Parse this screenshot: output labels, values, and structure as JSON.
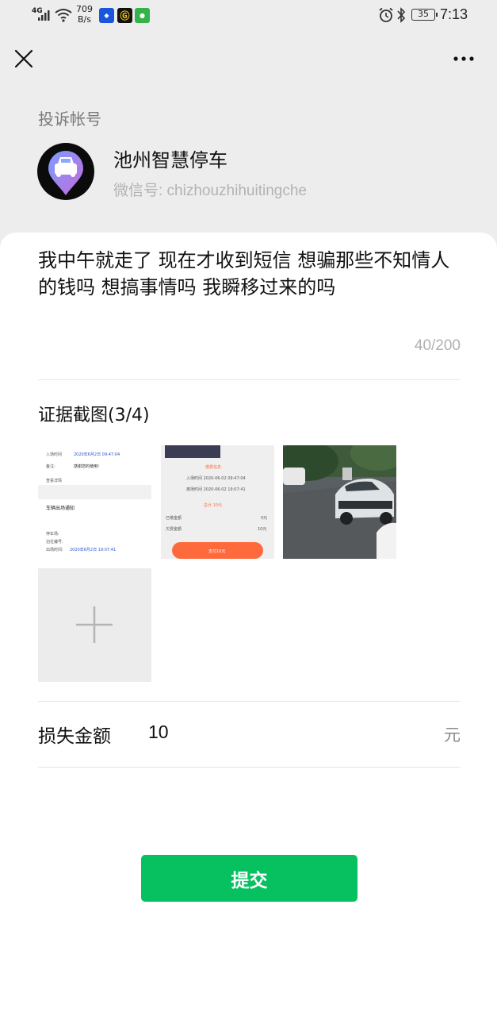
{
  "status_bar": {
    "network": "4G",
    "speed_value": "709",
    "speed_unit": "B/s",
    "battery": "35",
    "time": "7:13",
    "app_icons": [
      "shield-app-icon",
      "g-app-icon",
      "wechat-app-icon"
    ]
  },
  "nav": {
    "close_icon": "close-icon",
    "more_icon": "more-icon"
  },
  "account": {
    "section_label": "投诉帐号",
    "name": "池州智慧停车",
    "wechat_id": "微信号: chizhouzhihuitingche"
  },
  "complaint": {
    "text": "我中午就走了 现在才收到短信 想骗那些不知情人的钱吗 想搞事情吗 我瞬移过来的吗",
    "char_count": "40/200"
  },
  "evidence": {
    "title": "证据截图(3/4)",
    "thumbnails": [
      {
        "label": "screenshot-1",
        "lines": [
          "入场时间",
          "2020年6月2日 09:47:04",
          "备注:",
          "感谢您的使用!",
          "查看详情",
          "车辆出场通知",
          "停车场:",
          "泊位编号:",
          "出场时间:",
          "2020年6月2日 19:07:41"
        ]
      },
      {
        "label": "screenshot-2",
        "lines": [
          "缴费信息",
          "入场时间 2020-06-02 09:47:04",
          "离场时间 2020-06-02 19:07:41",
          "总计 10元",
          "已缴金额",
          "欠费金额",
          "0元",
          "10元",
          "支付10元"
        ]
      },
      {
        "label": "photo-3"
      }
    ],
    "add_icon": "plus-icon"
  },
  "loss": {
    "label": "损失金额",
    "value": "10",
    "unit": "元"
  },
  "submit": {
    "label": "提交"
  },
  "colors": {
    "accent": "#07c160",
    "background": "#ededed",
    "card": "#ffffff"
  }
}
